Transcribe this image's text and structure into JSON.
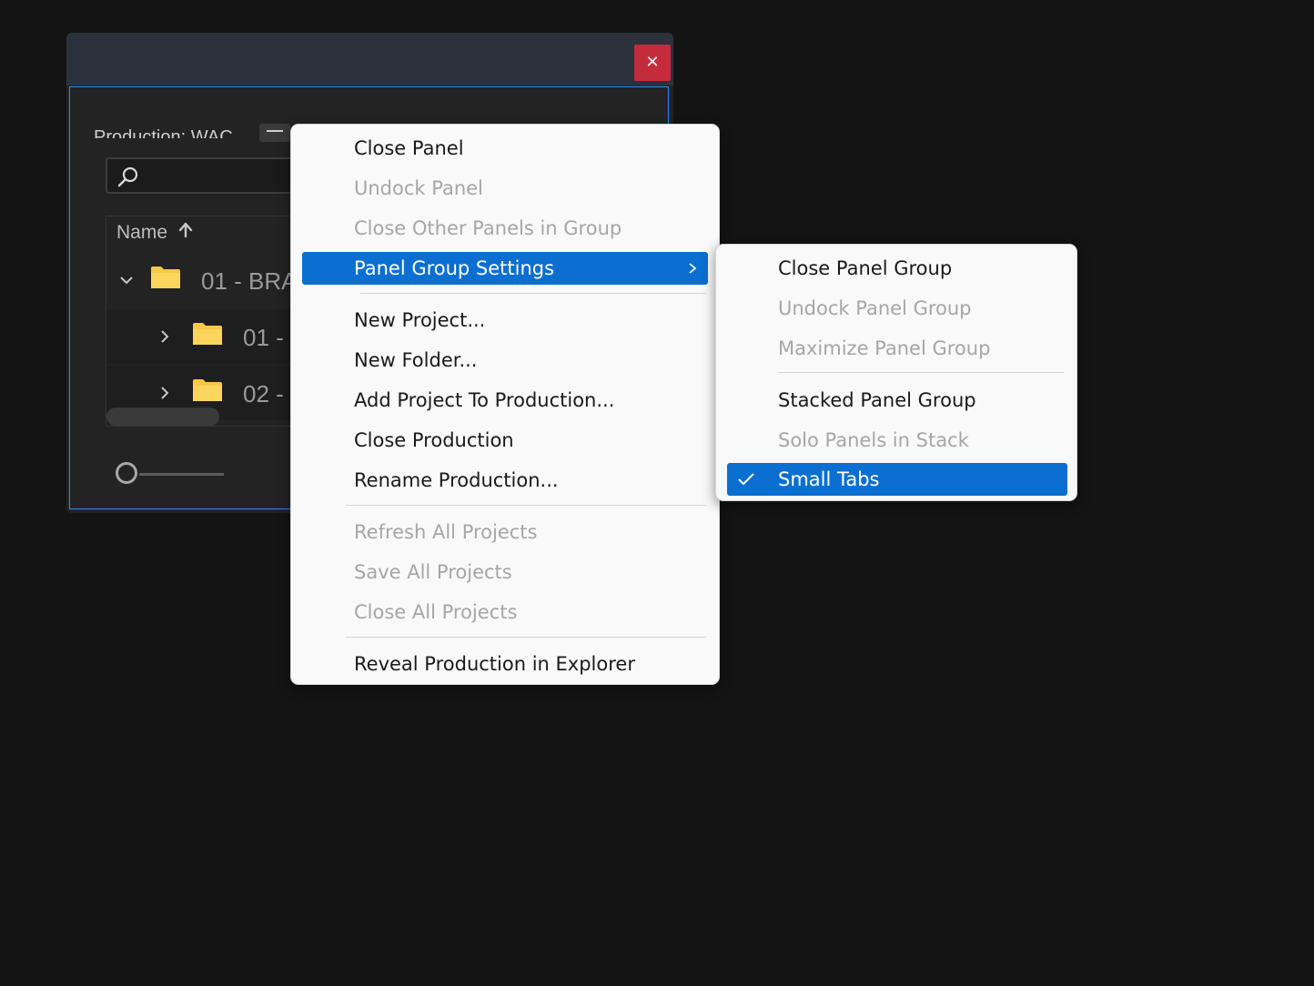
{
  "window": {
    "close_glyph": "✕",
    "panel_title": "Production: WAC",
    "column_header": "Name",
    "tree": [
      {
        "label": "01 - BRA",
        "expanded": true
      },
      {
        "label": "01 -",
        "expanded": false
      },
      {
        "label": "02 -",
        "expanded": false
      }
    ]
  },
  "context_menu": {
    "items": [
      {
        "label": "Close Panel",
        "enabled": true
      },
      {
        "label": "Undock Panel",
        "enabled": false
      },
      {
        "label": "Close Other Panels in Group",
        "enabled": false
      },
      {
        "label": "Panel Group Settings",
        "enabled": true,
        "has_submenu": true,
        "highlighted": true
      },
      {
        "label": "New Project...",
        "enabled": true
      },
      {
        "label": "New Folder...",
        "enabled": true
      },
      {
        "label": "Add Project To Production...",
        "enabled": true
      },
      {
        "label": "Close Production",
        "enabled": true
      },
      {
        "label": "Rename Production...",
        "enabled": true
      },
      {
        "label": "Refresh All Projects",
        "enabled": false
      },
      {
        "label": "Save All Projects",
        "enabled": false
      },
      {
        "label": "Close All Projects",
        "enabled": false
      },
      {
        "label": "Reveal Production in Explorer",
        "enabled": true
      }
    ]
  },
  "submenu": {
    "items": [
      {
        "label": "Close Panel Group",
        "enabled": true
      },
      {
        "label": "Undock Panel Group",
        "enabled": false
      },
      {
        "label": "Maximize Panel Group",
        "enabled": false
      },
      {
        "label": "Stacked Panel Group",
        "enabled": true
      },
      {
        "label": "Solo Panels in Stack",
        "enabled": false
      },
      {
        "label": "Small Tabs",
        "enabled": true,
        "checked": true,
        "highlighted": true
      }
    ]
  },
  "colors": {
    "highlight": "#0a6fd1",
    "close_button": "#c42b3c",
    "panel_focus_border": "#2d8ceb",
    "folder": "#f7c948"
  }
}
